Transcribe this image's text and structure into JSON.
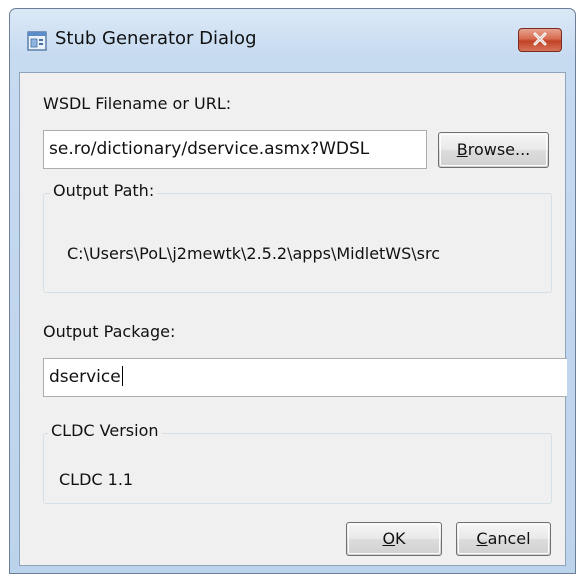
{
  "window": {
    "title": "Stub Generator Dialog",
    "icon": "application-icon",
    "close_icon": "close-icon"
  },
  "wsdl": {
    "label": "WSDL Filename or URL:",
    "value": "se.ro/dictionary/dservice.asmx?WDSL",
    "browse_label": "Browse...",
    "browse_mnemonic": "B"
  },
  "output_path": {
    "legend": "Output Path:",
    "value": "C:\\Users\\PoL\\j2mewtk\\2.5.2\\apps\\MidletWS\\src"
  },
  "output_package": {
    "label": "Output Package:",
    "value": "dservice"
  },
  "cldc": {
    "legend": "CLDC Version",
    "value": "CLDC 1.1"
  },
  "buttons": {
    "ok_label": "OK",
    "ok_mnemonic": "O",
    "cancel_label": "Cancel",
    "cancel_mnemonic": "C"
  },
  "colors": {
    "close_button": "#c9472b",
    "client_bg": "#f0f0f0",
    "frame": "#c6daf0"
  }
}
